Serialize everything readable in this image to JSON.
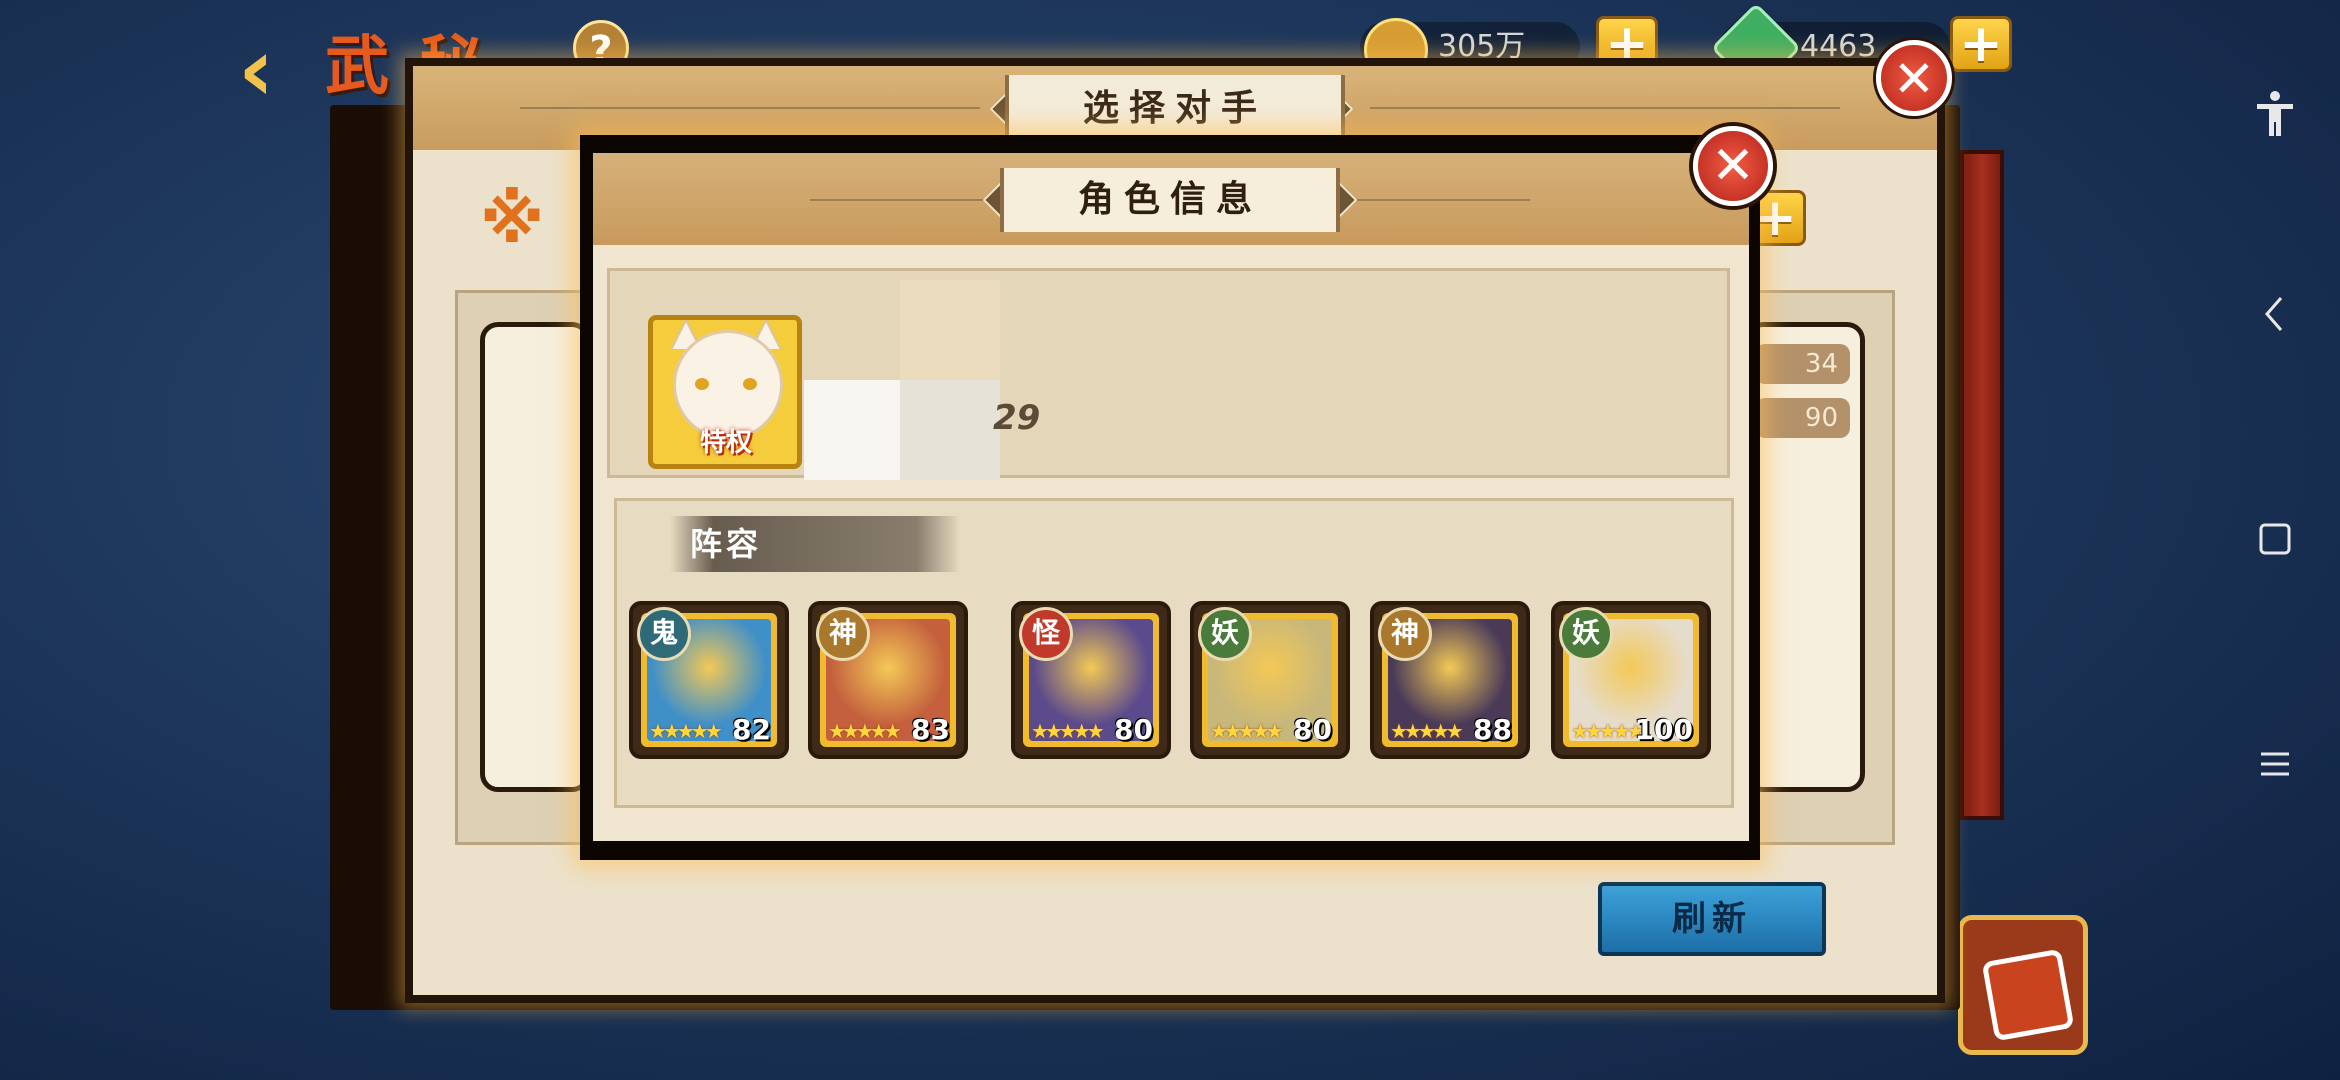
{
  "background": {
    "back_icon": "chevron-left-icon",
    "title_visible_chars": "武 秘",
    "help_label": "?",
    "coins": "305万",
    "gems": "4463",
    "plus_label": "+"
  },
  "outer_dialog": {
    "title": "选择对手",
    "close_label": "✕",
    "refresh_label": "刷新",
    "right_values": [
      "34",
      "90"
    ]
  },
  "inner_dialog": {
    "title": "角色信息",
    "close_label": "✕",
    "avatar_tag": "特权",
    "level_tail": "29",
    "lineup_label": "阵容"
  },
  "heroes": [
    {
      "badge": "鬼",
      "badge_color": "#2f6a78",
      "stars": "★★★★★",
      "level": "82",
      "portrait_color": "#3f8fc8"
    },
    {
      "badge": "神",
      "badge_color": "#a9782c",
      "stars": "★★★★★",
      "level": "83",
      "portrait_color": "#c4603e"
    },
    {
      "badge": "怪",
      "badge_color": "#c0392b",
      "stars": "★★★★★",
      "level": "80",
      "portrait_color": "#5b4a8c"
    },
    {
      "badge": "妖",
      "badge_color": "#4a7b3a",
      "stars": "★★★★★",
      "level": "80",
      "portrait_color": "#c8b77a"
    },
    {
      "badge": "神",
      "badge_color": "#a9782c",
      "stars": "★★★★★",
      "level": "88",
      "portrait_color": "#4a3a58"
    },
    {
      "badge": "妖",
      "badge_color": "#4a7b3a",
      "stars": "★★★★★",
      "level": "100",
      "portrait_color": "#e6dccb"
    }
  ],
  "android_nav": {
    "accessibility_icon": "accessibility-icon",
    "back_icon": "back-icon",
    "home_icon": "home-icon",
    "menu_icon": "menu-icon"
  }
}
